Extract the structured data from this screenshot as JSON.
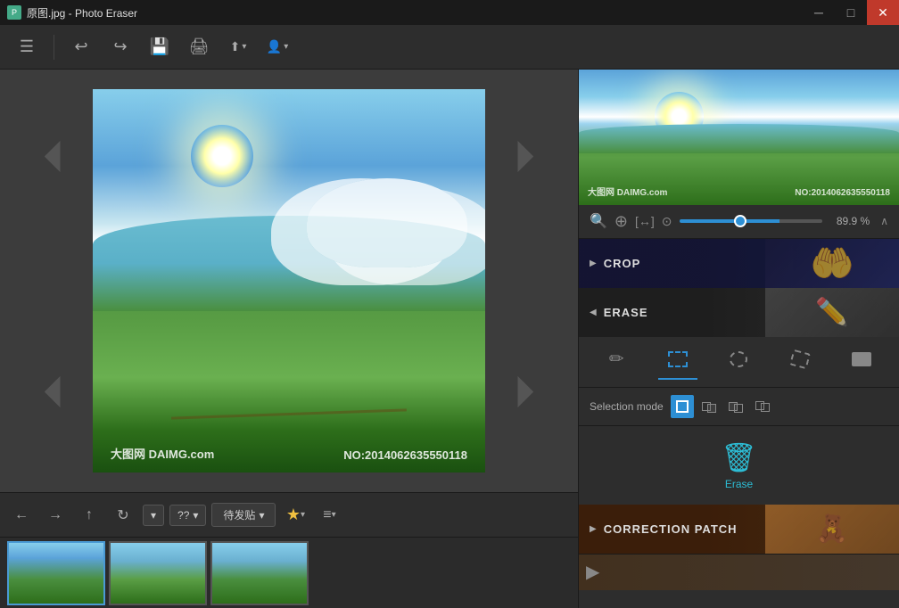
{
  "titlebar": {
    "title": "原图.jpg - Photo Eraser",
    "minimize_label": "─",
    "maximize_label": "□",
    "close_label": "✕"
  },
  "toolbar": {
    "undo_icon": "↩",
    "redo_icon": "↪",
    "save_icon": "💾",
    "print_icon": "🖨",
    "share_icon": "⬆",
    "user_icon": "👤",
    "share_label": "▾",
    "user_label": "▾"
  },
  "image": {
    "watermark_left": "大图网 DAIMG.com",
    "watermark_right": "NO:2014062635550118"
  },
  "preview": {
    "watermark_left": "大图网 DAIMG.com",
    "watermark_right": "NO:2014062635550118"
  },
  "zoom": {
    "percent": "89.9 %",
    "value": 89.9
  },
  "sections": {
    "crop_label": "CROP",
    "erase_label": "ERASE",
    "correction_label": "CORRECTION PATCH"
  },
  "erase_tools": [
    {
      "icon": "✏️",
      "label": "pen",
      "active": false
    },
    {
      "icon": "▢",
      "label": "rect",
      "active": true
    },
    {
      "icon": "○",
      "label": "lasso",
      "active": false
    },
    {
      "icon": "◌",
      "label": "poly",
      "active": false
    },
    {
      "icon": "⬜",
      "label": "eraser",
      "active": false
    }
  ],
  "selection_mode": {
    "label": "Selection mode",
    "modes": [
      "fill",
      "add",
      "subtract",
      "intersect"
    ]
  },
  "erase_button": {
    "label": "Erase"
  },
  "bottom_nav": {
    "back_icon": "←",
    "forward_icon": "→",
    "up_icon": "↑",
    "refresh_icon": "↻",
    "tag_label": "待发贴",
    "star_icon": "★",
    "list_icon": "≡"
  },
  "thumbnails": [
    {
      "id": 1,
      "selected": true
    },
    {
      "id": 2,
      "selected": false
    },
    {
      "id": 3,
      "selected": false
    }
  ]
}
